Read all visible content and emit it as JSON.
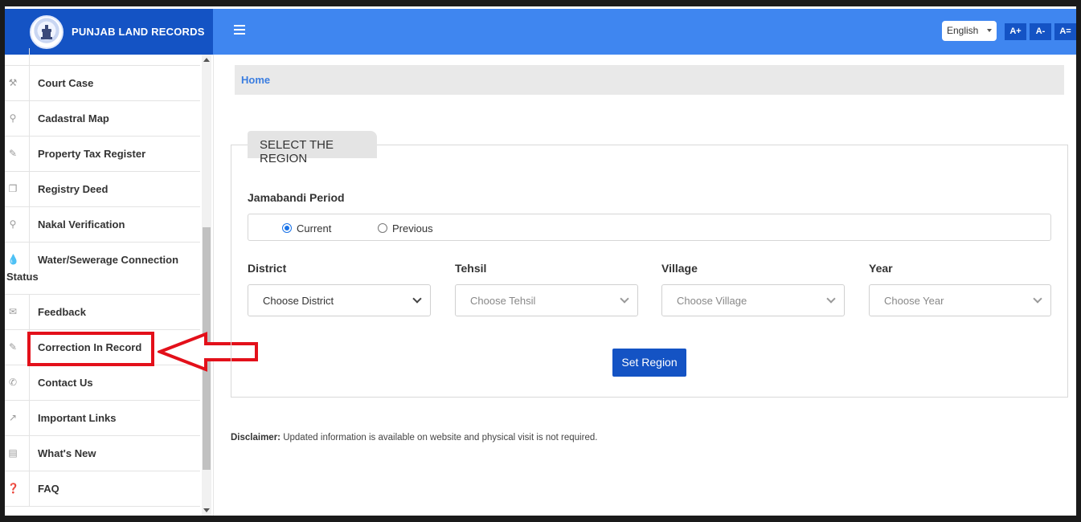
{
  "header": {
    "brand_title": "PUNJAB LAND RECORDS",
    "language": "English",
    "font_buttons": [
      "A+",
      "A-",
      "A="
    ]
  },
  "sidebar": {
    "items": [
      {
        "label": "Court Case",
        "icon": "gavel-icon"
      },
      {
        "label": "Cadastral Map",
        "icon": "map-marker-icon"
      },
      {
        "label": "Property Tax Register",
        "icon": "edit-icon"
      },
      {
        "label": "Registry Deed",
        "icon": "copy-icon"
      },
      {
        "label": "Nakal Verification",
        "icon": "search-icon"
      },
      {
        "label": "Water/Sewerage Connection",
        "label_line2": "Status",
        "icon": "water-drop-icon"
      },
      {
        "label": "Feedback",
        "icon": "comments-icon"
      },
      {
        "label": "Correction In Record",
        "icon": "edit-square-icon"
      },
      {
        "label": "Contact Us",
        "icon": "phone-icon"
      },
      {
        "label": "Important Links",
        "icon": "external-link-icon"
      },
      {
        "label": "What's New",
        "icon": "newspaper-icon"
      },
      {
        "label": "FAQ",
        "icon": "question-circle-icon"
      }
    ]
  },
  "breadcrumb": {
    "home": "Home"
  },
  "region": {
    "title": "SELECT THE REGION",
    "period_label": "Jamabandi Period",
    "period_options": [
      {
        "label": "Current",
        "checked": true
      },
      {
        "label": "Previous",
        "checked": false
      }
    ],
    "district": {
      "label": "District",
      "value": "Choose District"
    },
    "tehsil": {
      "label": "Tehsil",
      "value": "Choose Tehsil"
    },
    "village": {
      "label": "Village",
      "value": "Choose Village"
    },
    "year": {
      "label": "Year",
      "value": "Choose Year"
    },
    "submit": "Set Region"
  },
  "disclaimer": {
    "label": "Disclaimer:",
    "text": " Updated information is available on website and physical visit is not required."
  },
  "colors": {
    "brand": "#1453c4",
    "topbar": "#3f86f0",
    "highlight": "#e3101a"
  }
}
